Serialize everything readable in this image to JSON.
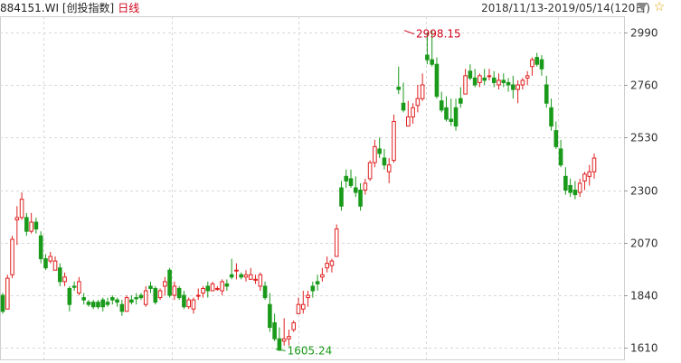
{
  "header": {
    "code": "884151.WI",
    "name": "[创投指数]",
    "period": "日线",
    "range": "2018/11/13-2019/05/14(120日)"
  },
  "icons": {
    "dropdown": "triangle-down-icon",
    "favorite": "star-icon"
  },
  "colors": {
    "up": "#e02020",
    "down": "#1a9a1a",
    "grid": "#d8d8d8",
    "annotation_high": "#d0021b",
    "annotation_low": "#1a9a1a"
  },
  "chart_data": {
    "type": "candlestick",
    "ylim": [
      1560,
      3060
    ],
    "yticks": [
      2990,
      2760,
      2530,
      2300,
      2070,
      1840,
      1610
    ],
    "grid": true,
    "annotations": [
      {
        "label": "2998.15",
        "value": 2998.15,
        "kind": "high",
        "index": 84
      },
      {
        "label": "1605.24",
        "value": 1605.24,
        "kind": "low",
        "index": 57
      }
    ],
    "candles": [
      [
        1840,
        1850,
        1760,
        1770
      ],
      [
        1780,
        1930,
        1780,
        1915
      ],
      [
        1930,
        2100,
        1915,
        2085
      ],
      [
        2170,
        2230,
        2060,
        2180
      ],
      [
        2180,
        2290,
        2170,
        2260
      ],
      [
        2180,
        2200,
        2100,
        2120
      ],
      [
        2120,
        2200,
        2110,
        2160
      ],
      [
        2160,
        2180,
        2110,
        2130
      ],
      [
        2100,
        2120,
        1980,
        2000
      ],
      [
        2000,
        2020,
        1950,
        1960
      ],
      [
        1990,
        2030,
        1980,
        2010
      ],
      [
        1950,
        2010,
        1950,
        1990
      ],
      [
        1960,
        1980,
        1880,
        1900
      ],
      [
        1900,
        1940,
        1880,
        1920
      ],
      [
        1870,
        1880,
        1770,
        1800
      ],
      [
        1880,
        1900,
        1860,
        1875
      ],
      [
        1850,
        1920,
        1840,
        1900
      ],
      [
        1830,
        1850,
        1800,
        1820
      ],
      [
        1810,
        1820,
        1790,
        1800
      ],
      [
        1810,
        1820,
        1780,
        1790
      ],
      [
        1810,
        1820,
        1780,
        1790
      ],
      [
        1820,
        1830,
        1770,
        1790
      ],
      [
        1810,
        1830,
        1790,
        1800
      ],
      [
        1830,
        1840,
        1800,
        1820
      ],
      [
        1820,
        1830,
        1790,
        1810
      ],
      [
        1800,
        1820,
        1750,
        1770
      ],
      [
        1770,
        1840,
        1770,
        1830
      ],
      [
        1820,
        1840,
        1800,
        1810
      ],
      [
        1830,
        1850,
        1800,
        1825
      ],
      [
        1840,
        1850,
        1820,
        1830
      ],
      [
        1800,
        1880,
        1790,
        1860
      ],
      [
        1880,
        1900,
        1850,
        1870
      ],
      [
        1870,
        1880,
        1800,
        1810
      ],
      [
        1830,
        1870,
        1820,
        1860
      ],
      [
        1880,
        1920,
        1840,
        1900
      ],
      [
        1950,
        1960,
        1830,
        1840
      ],
      [
        1840,
        1900,
        1820,
        1880
      ],
      [
        1870,
        1880,
        1820,
        1830
      ],
      [
        1840,
        1860,
        1780,
        1790
      ],
      [
        1790,
        1830,
        1780,
        1820
      ],
      [
        1780,
        1830,
        1760,
        1820
      ],
      [
        1840,
        1870,
        1820,
        1840
      ],
      [
        1850,
        1880,
        1830,
        1870
      ],
      [
        1880,
        1900,
        1830,
        1860
      ],
      [
        1860,
        1900,
        1860,
        1890
      ],
      [
        1870,
        1880,
        1860,
        1870
      ],
      [
        1860,
        1910,
        1840,
        1900
      ],
      [
        1890,
        1910,
        1860,
        1880
      ],
      [
        1930,
        2000,
        1910,
        1920
      ],
      [
        1950,
        1980,
        1910,
        1950
      ],
      [
        1930,
        1940,
        1910,
        1920
      ],
      [
        1920,
        1950,
        1900,
        1930
      ],
      [
        1910,
        1960,
        1910,
        1930
      ],
      [
        1910,
        1930,
        1890,
        1910
      ],
      [
        1880,
        1940,
        1860,
        1930
      ],
      [
        1880,
        1900,
        1820,
        1830
      ],
      [
        1800,
        1850,
        1680,
        1700
      ],
      [
        1720,
        1760,
        1640,
        1650
      ],
      [
        1650,
        1700,
        1600,
        1600
      ],
      [
        1640,
        1740,
        1620,
        1650
      ],
      [
        1650,
        1690,
        1620,
        1660
      ],
      [
        1690,
        1730,
        1680,
        1720
      ],
      [
        1760,
        1830,
        1760,
        1800
      ],
      [
        1780,
        1860,
        1760,
        1800
      ],
      [
        1830,
        1860,
        1790,
        1840
      ],
      [
        1880,
        1900,
        1830,
        1860
      ],
      [
        1900,
        1930,
        1860,
        1890
      ],
      [
        1920,
        1960,
        1900,
        1930
      ],
      [
        1960,
        2010,
        1940,
        1980
      ],
      [
        1970,
        2000,
        1940,
        1990
      ],
      [
        2010,
        2150,
        2010,
        2130
      ],
      [
        2310,
        2340,
        2210,
        2230
      ],
      [
        2360,
        2390,
        2310,
        2340
      ],
      [
        2350,
        2390,
        2310,
        2320
      ],
      [
        2310,
        2360,
        2270,
        2290
      ],
      [
        2300,
        2330,
        2210,
        2230
      ],
      [
        2300,
        2350,
        2280,
        2330
      ],
      [
        2350,
        2430,
        2340,
        2420
      ],
      [
        2420,
        2520,
        2400,
        2490
      ],
      [
        2480,
        2530,
        2440,
        2460
      ],
      [
        2440,
        2480,
        2390,
        2410
      ],
      [
        2380,
        2440,
        2330,
        2410
      ],
      [
        2430,
        2630,
        2420,
        2600
      ],
      [
        2750,
        2840,
        2720,
        2740
      ],
      [
        2680,
        2770,
        2640,
        2650
      ],
      [
        2580,
        2690,
        2580,
        2620
      ],
      [
        2620,
        2680,
        2590,
        2660
      ],
      [
        2670,
        2760,
        2640,
        2700
      ],
      [
        2700,
        2810,
        2690,
        2760
      ],
      [
        2890,
        2990,
        2850,
        2870
      ],
      [
        2870,
        3000,
        2840,
        2850
      ],
      [
        2850,
        2880,
        2700,
        2710
      ],
      [
        2690,
        2730,
        2640,
        2650
      ],
      [
        2660,
        2710,
        2600,
        2610
      ],
      [
        2610,
        2700,
        2580,
        2600
      ],
      [
        2660,
        2700,
        2560,
        2580
      ],
      [
        2700,
        2750,
        2660,
        2680
      ],
      [
        2720,
        2830,
        2720,
        2800
      ],
      [
        2820,
        2850,
        2780,
        2790
      ],
      [
        2790,
        2830,
        2750,
        2760
      ],
      [
        2770,
        2810,
        2750,
        2800
      ],
      [
        2790,
        2830,
        2760,
        2780
      ],
      [
        2800,
        2830,
        2780,
        2800
      ],
      [
        2790,
        2820,
        2750,
        2770
      ],
      [
        2760,
        2810,
        2740,
        2780
      ],
      [
        2780,
        2810,
        2750,
        2770
      ],
      [
        2770,
        2790,
        2730,
        2760
      ],
      [
        2760,
        2800,
        2700,
        2740
      ],
      [
        2740,
        2780,
        2680,
        2760
      ],
      [
        2760,
        2790,
        2740,
        2780
      ],
      [
        2790,
        2820,
        2760,
        2800
      ],
      [
        2840,
        2880,
        2800,
        2870
      ],
      [
        2880,
        2900,
        2840,
        2850
      ],
      [
        2870,
        2890,
        2800,
        2830
      ],
      [
        2760,
        2800,
        2660,
        2680
      ],
      [
        2660,
        2700,
        2560,
        2580
      ],
      [
        2560,
        2600,
        2480,
        2490
      ],
      [
        2480,
        2520,
        2400,
        2410
      ],
      [
        2360,
        2400,
        2280,
        2300
      ],
      [
        2320,
        2350,
        2270,
        2290
      ],
      [
        2300,
        2340,
        2260,
        2280
      ],
      [
        2290,
        2350,
        2270,
        2330
      ],
      [
        2340,
        2380,
        2300,
        2370
      ],
      [
        2360,
        2410,
        2320,
        2380
      ],
      [
        2380,
        2460,
        2350,
        2440
      ]
    ]
  }
}
